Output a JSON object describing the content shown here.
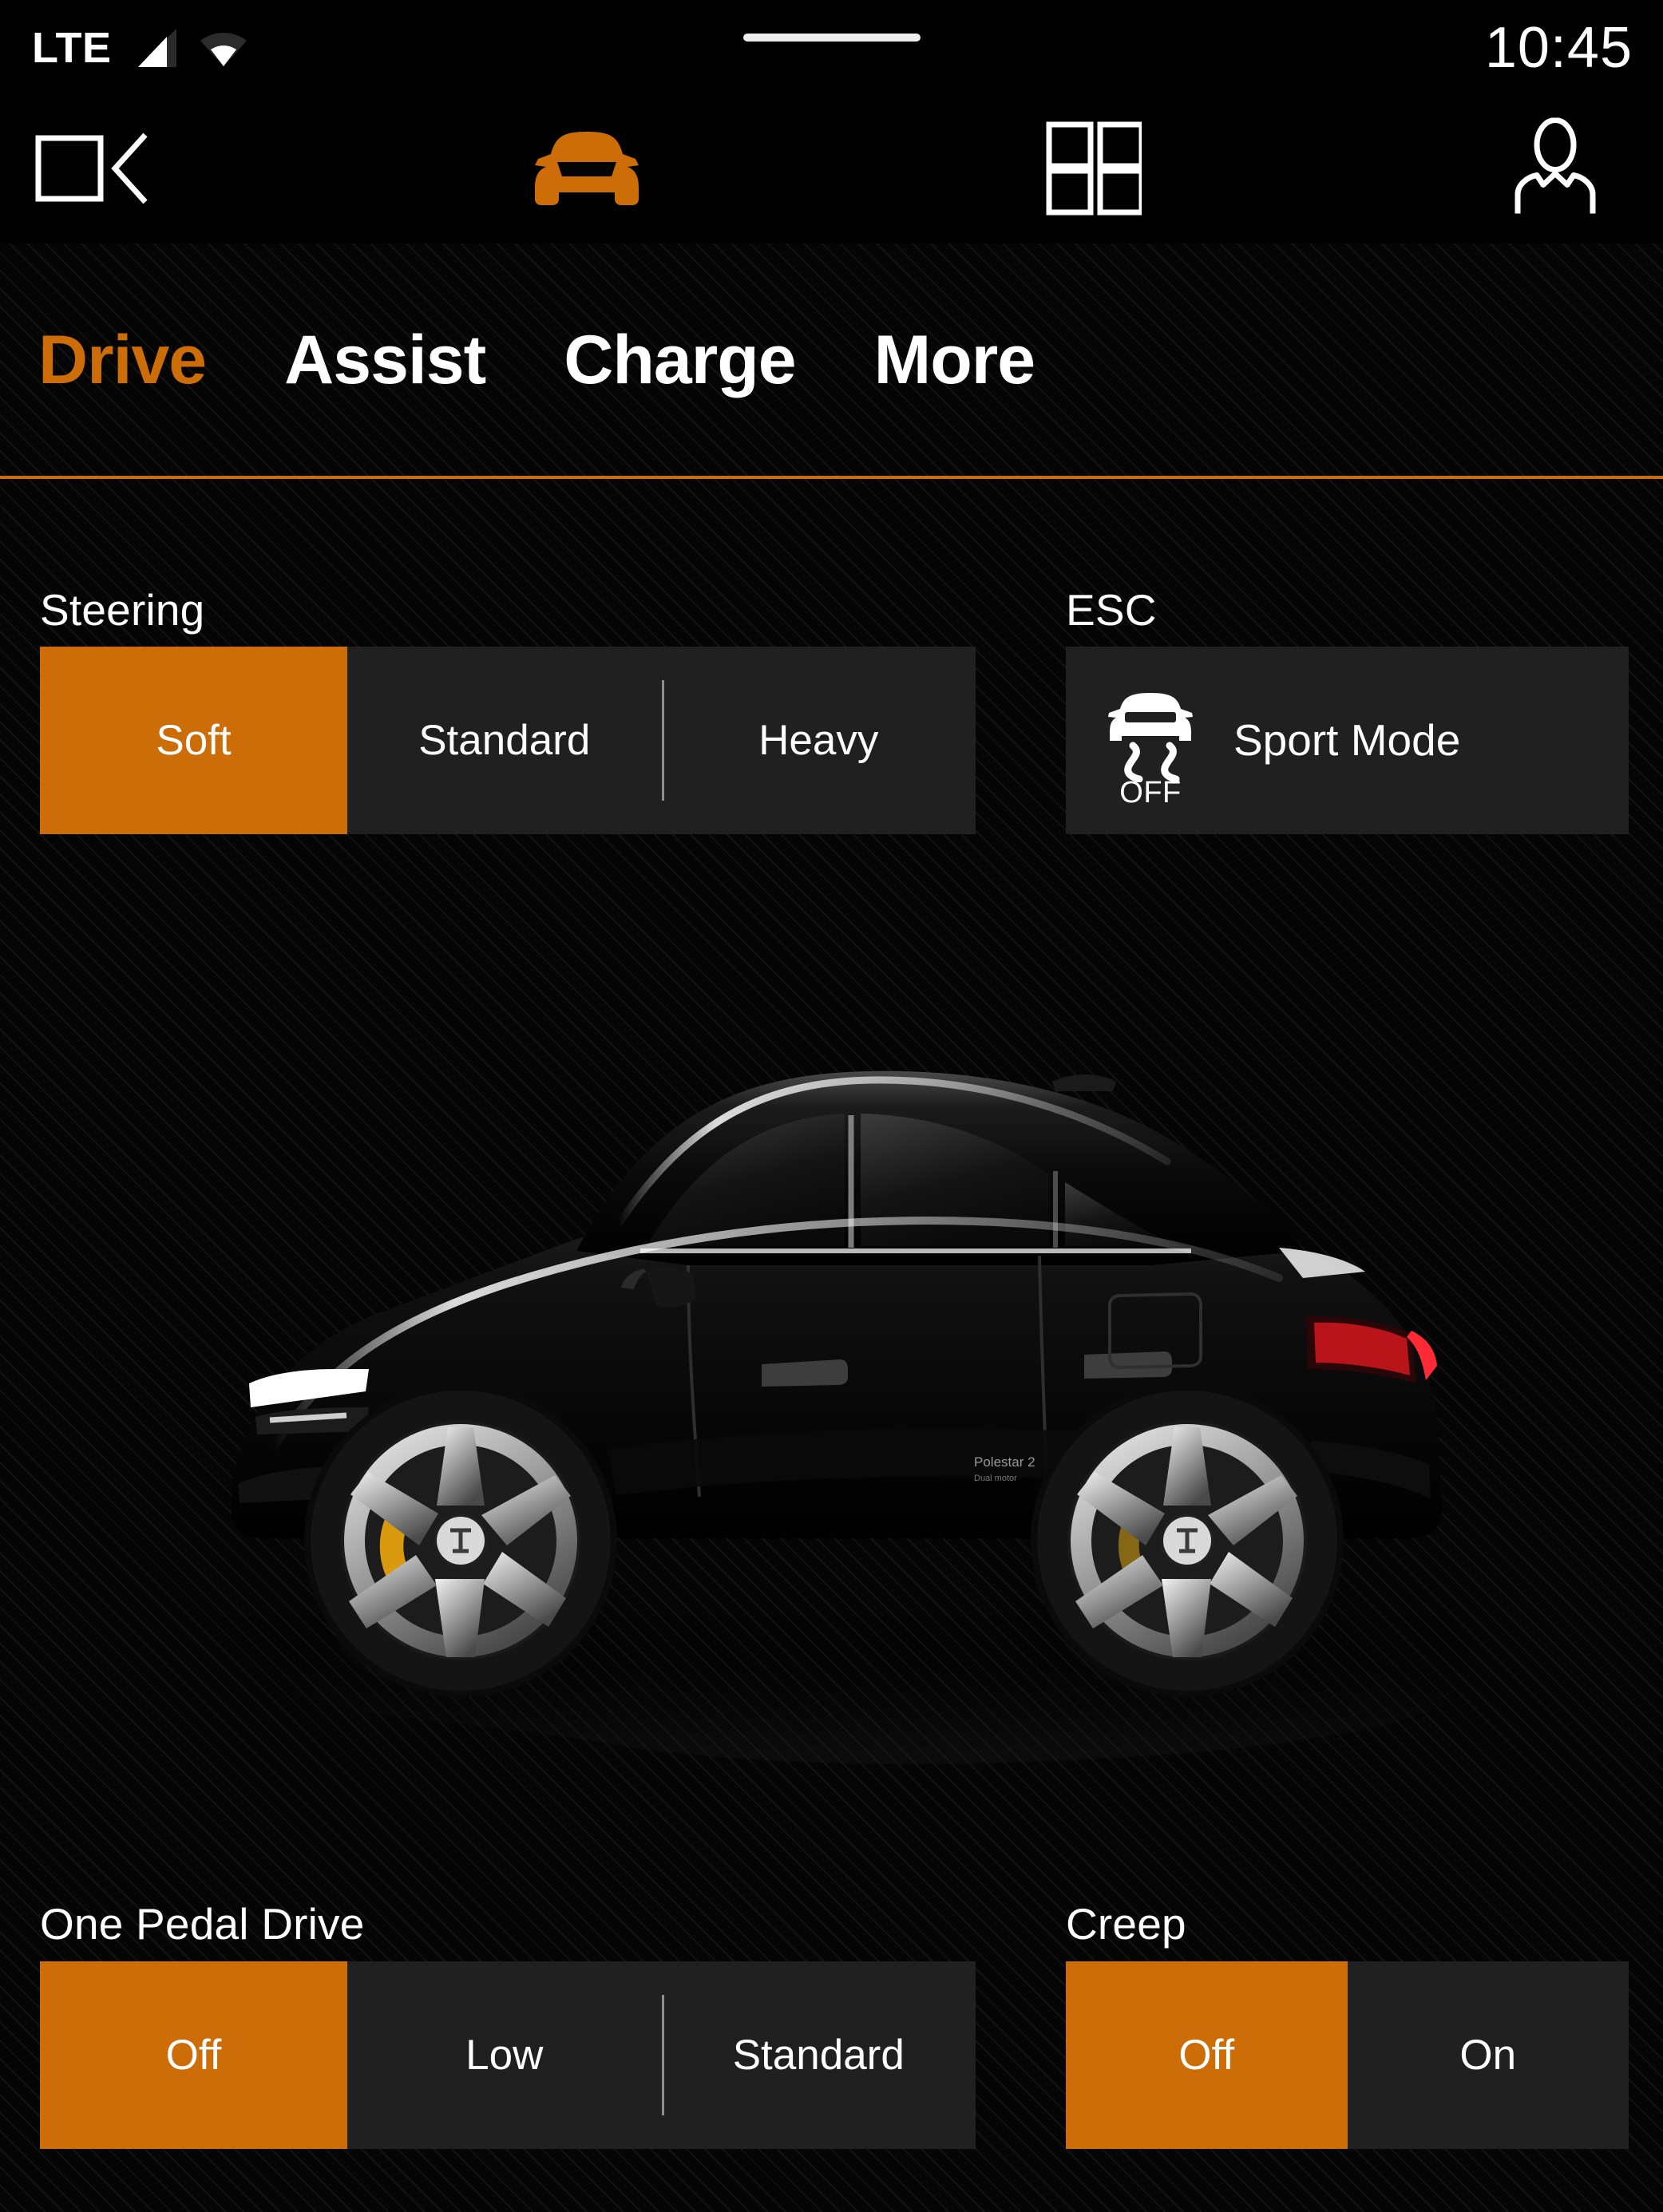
{
  "status_bar": {
    "network_label": "LTE",
    "signal_icon": "cellular-signal-icon",
    "wifi_icon": "wifi-icon",
    "clock": "10:45"
  },
  "nav_bar": {
    "items": [
      {
        "icon": "media-cast-icon",
        "name": "media",
        "active": false
      },
      {
        "icon": "car-front-icon",
        "name": "car",
        "active": true
      },
      {
        "icon": "app-grid-icon",
        "name": "apps",
        "active": false
      },
      {
        "icon": "user-profile-icon",
        "name": "profile",
        "active": false
      }
    ]
  },
  "tabs": [
    {
      "label": "Drive",
      "active": true
    },
    {
      "label": "Assist",
      "active": false
    },
    {
      "label": "Charge",
      "active": false
    },
    {
      "label": "More",
      "active": false
    }
  ],
  "controls": {
    "steering": {
      "label": "Steering",
      "options": [
        "Soft",
        "Standard",
        "Heavy"
      ],
      "selected": "Soft"
    },
    "esc": {
      "label": "ESC",
      "button_label": "Sport Mode",
      "icon": "esc-off-icon",
      "icon_caption": "OFF",
      "active": false
    },
    "one_pedal_drive": {
      "label": "One Pedal Drive",
      "options": [
        "Off",
        "Low",
        "Standard"
      ],
      "selected": "Off"
    },
    "creep": {
      "label": "Creep",
      "options": [
        "Off",
        "On"
      ],
      "selected": "Off"
    }
  },
  "vehicle_image": {
    "name": "polestar-2-side-view",
    "body_color": "#0b0b0b",
    "caliper_color": "#d99a10",
    "taillight_color": "#c8161d"
  },
  "colors": {
    "accent": "#CC6D07",
    "surface": "#202020",
    "background": "#050505",
    "text": "#ffffff"
  }
}
